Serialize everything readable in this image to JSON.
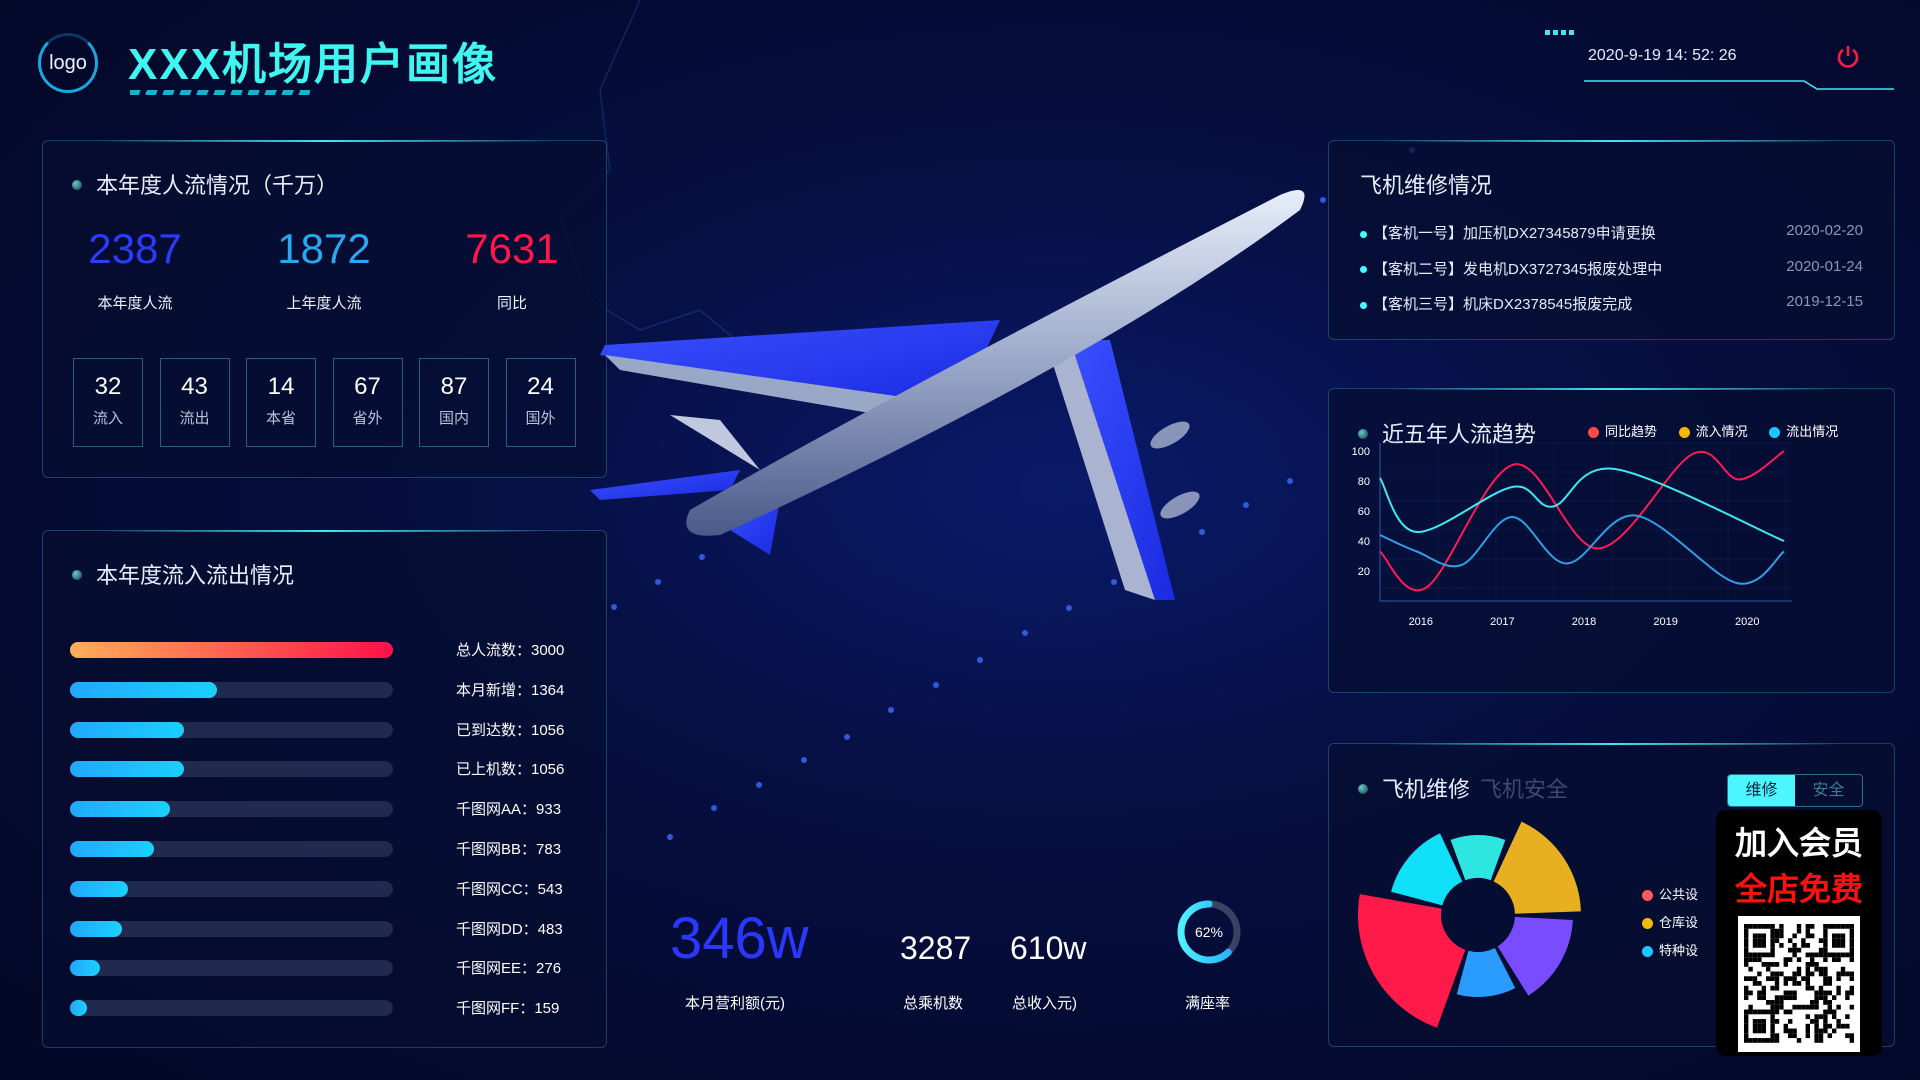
{
  "header": {
    "logo_text": "logo",
    "title": "XXX机场用户画像",
    "datetime": "2020-9-19 14: 52: 26",
    "power_icon": "power-icon",
    "accent": "#3ff6f0"
  },
  "traffic": {
    "title": "本年度人流情况（千万）",
    "main": [
      {
        "value": "2387",
        "label": "本年度人流",
        "color": "#2a3cff"
      },
      {
        "value": "1872",
        "label": "上年度人流",
        "color": "#29a8f0"
      },
      {
        "value": "7631",
        "label": "同比",
        "color": "#ff1848"
      }
    ],
    "stats": [
      {
        "value": "32",
        "label": "流入"
      },
      {
        "value": "43",
        "label": "流出"
      },
      {
        "value": "14",
        "label": "本省"
      },
      {
        "value": "67",
        "label": "省外"
      },
      {
        "value": "87",
        "label": "国内"
      },
      {
        "value": "24",
        "label": "国外"
      }
    ]
  },
  "flow": {
    "title": "本年度流入流出情况",
    "max": 3000,
    "items": [
      {
        "label": "总人流数：3000",
        "value": 3000
      },
      {
        "label": "本月新增：1364",
        "value": 1364
      },
      {
        "label": "已到达数：1056",
        "value": 1056
      },
      {
        "label": "已上机数：1056",
        "value": 1056
      },
      {
        "label": "千图网AA：933",
        "value": 933
      },
      {
        "label": "千图网BB：783",
        "value": 783
      },
      {
        "label": "千图网CC：543",
        "value": 543
      },
      {
        "label": "千图网DD：483",
        "value": 483
      },
      {
        "label": "千图网EE：276",
        "value": 276
      },
      {
        "label": "千图网FF：159",
        "value": 159
      }
    ]
  },
  "kpis": [
    {
      "value": "346w",
      "label": "本月营利额(元)"
    },
    {
      "value": "3287",
      "label": "总乘机数"
    },
    {
      "value": "610w",
      "label": "总收入元)"
    },
    {
      "value": "62%",
      "label": "满座率",
      "percent": 62
    }
  ],
  "maintenance": {
    "title": "飞机维修情况",
    "items": [
      {
        "text": "【客机一号】加压机DX27345879申请更换",
        "date": "2020-02-20"
      },
      {
        "text": "【客机二号】发电机DX3727345报废处理中",
        "date": "2020-01-24"
      },
      {
        "text": "【客机三号】机床DX2378545报废完成",
        "date": "2019-12-15"
      }
    ]
  },
  "trend": {
    "title": "近五年人流趋势"
  },
  "repair": {
    "title": "飞机维修",
    "subtitle": "飞机安全",
    "tabs": [
      {
        "label": "维修",
        "active": true
      },
      {
        "label": "安全",
        "active": false
      }
    ],
    "legend": [
      {
        "label": "公共设",
        "color": "#ff5a5a"
      },
      {
        "label": "仓库设",
        "color": "#f5b800"
      },
      {
        "label": "特种设",
        "color": "#18c8ff"
      }
    ]
  },
  "ad": {
    "line1": "加入会员",
    "line2": "全店免费"
  },
  "chart_data": [
    {
      "type": "line",
      "title": "近五年人流趋势",
      "xlim": [
        2015.5,
        2020.45
      ],
      "ylim": [
        0,
        100
      ],
      "x_ticks": [
        "2016",
        "2017",
        "2018",
        "2019",
        "2020"
      ],
      "y_ticks": [
        "20",
        "40",
        "60",
        "80",
        "100"
      ],
      "grid": true,
      "legend": "top-right",
      "series": [
        {
          "name": "同比趋势",
          "color": "#ff1a55",
          "legend_color": "#ff4a4a",
          "points": [
            [
              2015.5,
              33
            ],
            [
              2016.07,
              9
            ],
            [
              2017.14,
              91
            ],
            [
              2018.18,
              35
            ],
            [
              2019.33,
              98
            ],
            [
              2019.9,
              81
            ],
            [
              2020.45,
              100
            ]
          ]
        },
        {
          "name": "流入情况",
          "color": "#3ee8f0",
          "legend_color": "#f5b800",
          "points": [
            [
              2015.5,
              82
            ],
            [
              2015.95,
              46
            ],
            [
              2017.12,
              76
            ],
            [
              2017.62,
              63
            ],
            [
              2018.38,
              88
            ],
            [
              2020.45,
              40
            ]
          ]
        },
        {
          "name": "流出情况",
          "color": "#2f9fe8",
          "legend_color": "#18c8ff",
          "points": [
            [
              2015.5,
              44
            ],
            [
              2015.95,
              33
            ],
            [
              2016.5,
              24
            ],
            [
              2017.12,
              56
            ],
            [
              2017.79,
              25
            ],
            [
              2018.63,
              57
            ],
            [
              2019.87,
              12
            ],
            [
              2020.45,
              33
            ]
          ]
        }
      ]
    },
    {
      "type": "pie",
      "subtype": "rose",
      "values": [
        40,
        63,
        55,
        42,
        80,
        50
      ],
      "colors": [
        "#2de6e0",
        "#e8b020",
        "#7a4cff",
        "#2a9cff",
        "#ff1a4a",
        "#10e0f8"
      ]
    }
  ]
}
